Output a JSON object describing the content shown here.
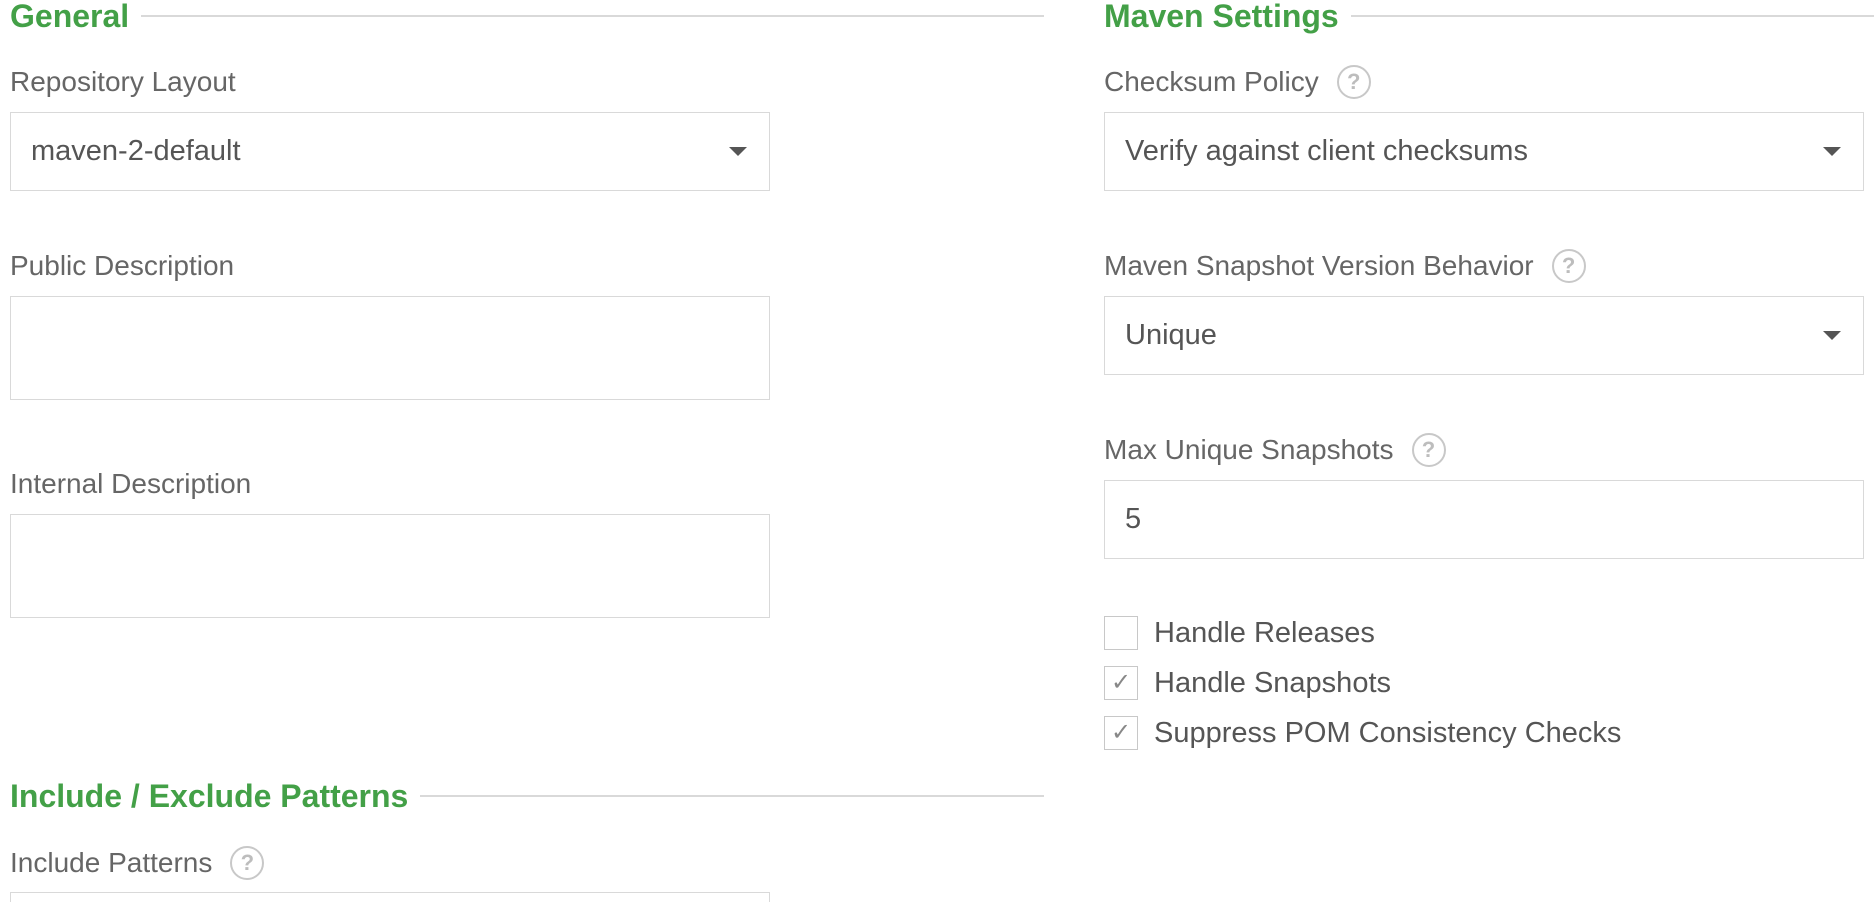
{
  "general": {
    "title": "General",
    "repository_layout": {
      "label": "Repository Layout",
      "value": "maven-2-default"
    },
    "public_description": {
      "label": "Public Description",
      "value": ""
    },
    "internal_description": {
      "label": "Internal Description",
      "value": ""
    }
  },
  "maven_settings": {
    "title": "Maven Settings",
    "checksum_policy": {
      "label": "Checksum Policy",
      "help_icon": "?",
      "value": "Verify against client checksums"
    },
    "snapshot_behavior": {
      "label": "Maven Snapshot Version Behavior",
      "help_icon": "?",
      "value": "Unique"
    },
    "max_unique_snapshots": {
      "label": "Max Unique Snapshots",
      "help_icon": "?",
      "value": "5"
    },
    "checkboxes": [
      {
        "label": "Handle Releases",
        "checked": false,
        "mark": ""
      },
      {
        "label": "Handle Snapshots",
        "checked": true,
        "mark": "✓"
      },
      {
        "label": "Suppress POM Consistency Checks",
        "checked": true,
        "mark": "✓"
      }
    ]
  },
  "patterns": {
    "title": "Include / Exclude Patterns",
    "include_patterns": {
      "label": "Include Patterns",
      "help_icon": "?"
    }
  },
  "colors": {
    "accent": "#43a047",
    "border": "#d9d9d9",
    "text": "#555555"
  }
}
